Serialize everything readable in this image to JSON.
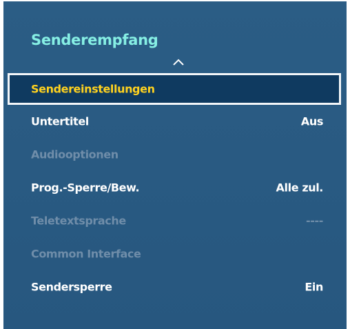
{
  "panel": {
    "title": "Senderempfang",
    "scroll_indicator_icon": "chevron-up-icon"
  },
  "colors": {
    "panel_background": "#2a5b83",
    "title_color": "#86efe4",
    "selected_background": "#0f3a60",
    "selected_text": "#ffd21f",
    "selected_border": "#f3f6f9",
    "enabled_text": "#ffffff",
    "disabled_text": "#6f8da9"
  },
  "menu": {
    "items": [
      {
        "label": "Sendereinstellungen",
        "value": "",
        "state": "selected"
      },
      {
        "label": "Untertitel",
        "value": "Aus",
        "state": "enabled"
      },
      {
        "label": "Audiooptionen",
        "value": "",
        "state": "disabled"
      },
      {
        "label": "Prog.-Sperre/Bew.",
        "value": "Alle zul.",
        "state": "enabled"
      },
      {
        "label": "Teletextsprache",
        "value": "----",
        "state": "disabled"
      },
      {
        "label": "Common Interface",
        "value": "",
        "state": "disabled"
      },
      {
        "label": "Sendersperre",
        "value": "Ein",
        "state": "enabled"
      }
    ]
  }
}
